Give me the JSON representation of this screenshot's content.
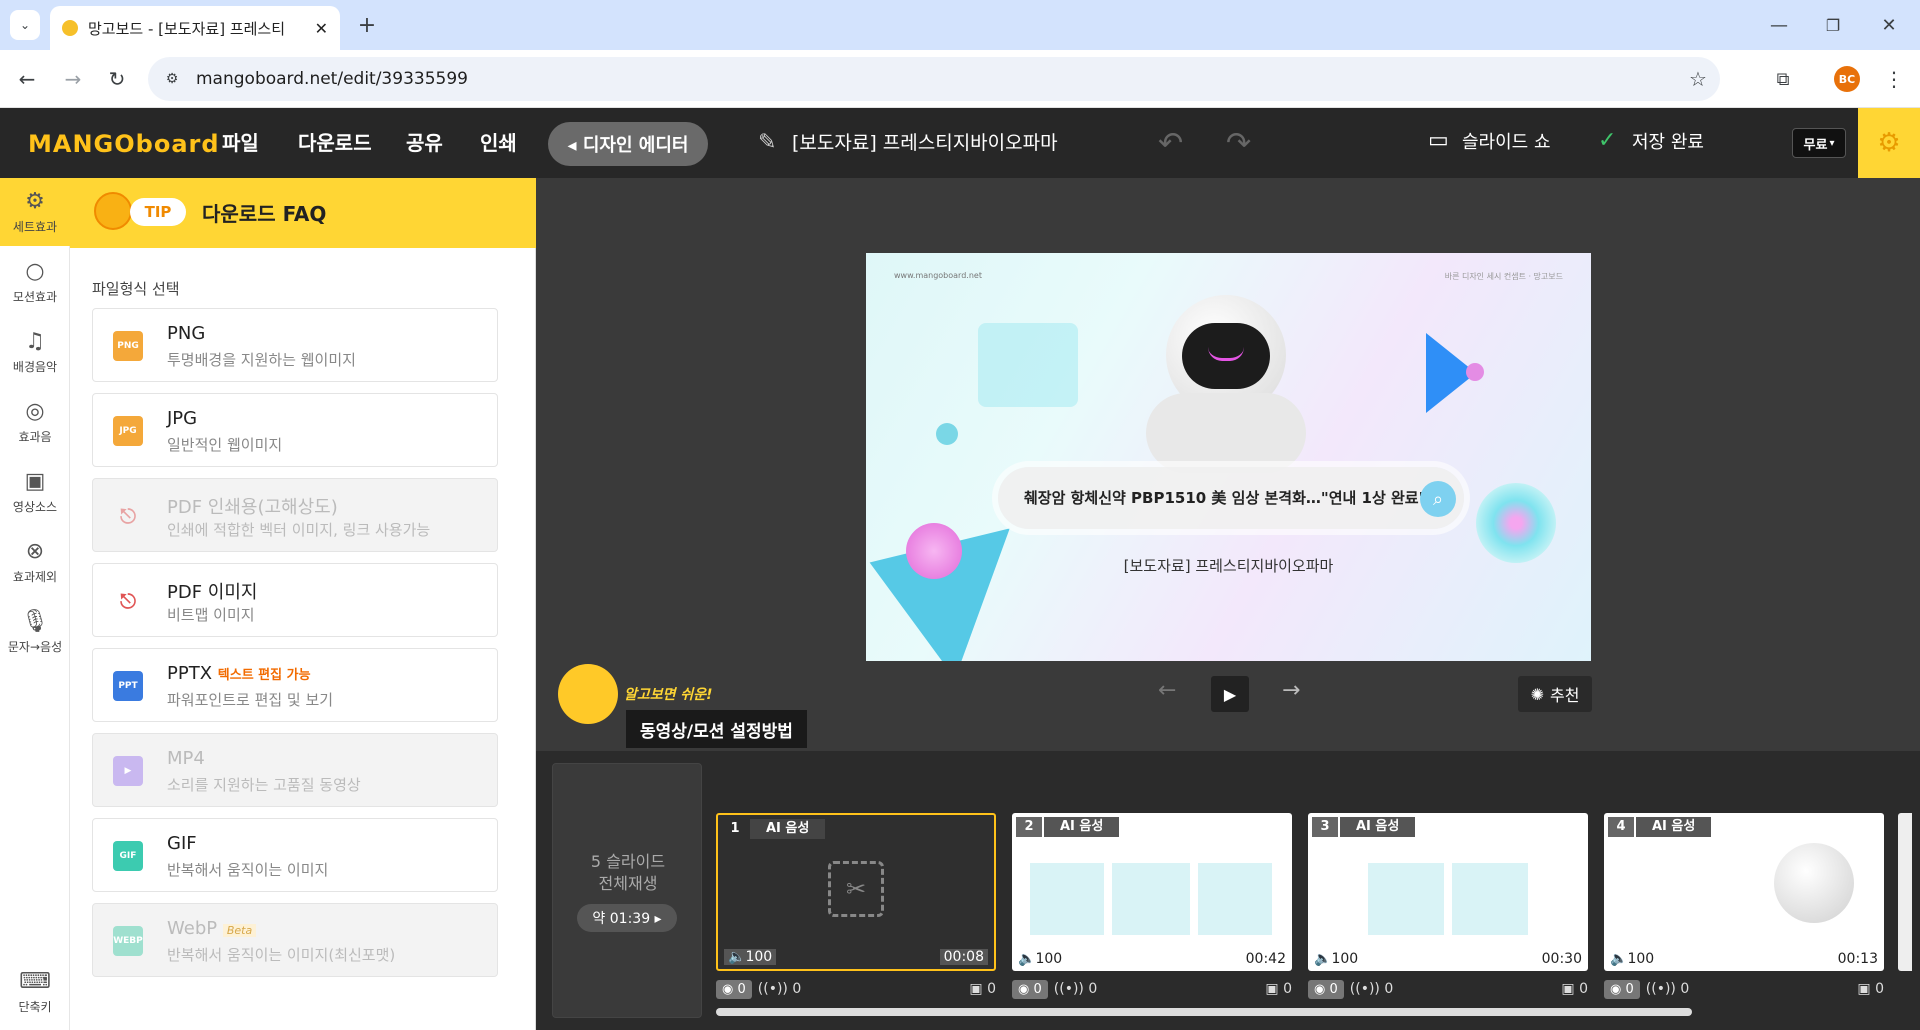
{
  "browser": {
    "tab_title": "망고보드 - [보도자료] 프레스티",
    "url": "mangoboard.net/edit/39335599",
    "profile": "BC"
  },
  "header": {
    "logo": "MANGOboard",
    "menu": [
      "파일",
      "다운로드",
      "공유",
      "인쇄"
    ],
    "design_editor": "◂ 디자인 에디터",
    "doc_title": "[보도자료] 프레스티지바이오파마",
    "slideshow": "슬라이드 쇼",
    "save_status": "저장 완료",
    "plan": "무료"
  },
  "tools": [
    {
      "label": "세트효과",
      "icon": "gear-icon"
    },
    {
      "label": "모션효과",
      "icon": "circle-icon"
    },
    {
      "label": "배경음악",
      "icon": "music-icon"
    },
    {
      "label": "효과음",
      "icon": "target-icon"
    },
    {
      "label": "영상소스",
      "icon": "film-icon"
    },
    {
      "label": "효과제외",
      "icon": "cancel-icon"
    },
    {
      "label": "문자→음성",
      "icon": "mic-icon"
    },
    {
      "label": "단축키",
      "icon": "keyboard-icon"
    }
  ],
  "panel": {
    "tip_badge": "TIP",
    "tip_title": "다운로드 FAQ",
    "section_label": "파일형식 선택",
    "formats": [
      {
        "name": "PNG",
        "desc": "투명배경을 지원하는 웹이미지",
        "color": "#f4a83a",
        "enabled": true,
        "tag": ""
      },
      {
        "name": "JPG",
        "desc": "일반적인 웹이미지",
        "color": "#f4a83a",
        "enabled": true,
        "tag": ""
      },
      {
        "name": "PDF 인쇄용(고해상도)",
        "desc": "인쇄에 적합한 벡터 이미지, 링크 사용가능",
        "color": "#e8a3a3",
        "enabled": false,
        "tag": ""
      },
      {
        "name": "PDF 이미지",
        "desc": "비트맵 이미지",
        "color": "#e05555",
        "enabled": true,
        "tag": ""
      },
      {
        "name": "PPTX",
        "desc": "파워포인트로 편집 및 보기",
        "color": "#3a7be0",
        "enabled": true,
        "tag": "텍스트 편집 가능"
      },
      {
        "name": "MP4",
        "desc": "소리를 지원하는 고품질 동영상",
        "color": "#c9b8f0",
        "enabled": false,
        "tag": ""
      },
      {
        "name": "GIF",
        "desc": "반복해서 움직이는 이미지",
        "color": "#3ccbb0",
        "enabled": true,
        "tag": ""
      },
      {
        "name": "WebP",
        "desc": "반복해서 움직이는 이미지(최신포맷)",
        "color": "#9fe0cf",
        "enabled": false,
        "tag": "Beta"
      }
    ]
  },
  "slide": {
    "site": "www.mangoboard.net",
    "top_right": "바른 디자인 세시 컨셉트 · 망고보드",
    "search_text": "췌장암 항체신약 PBP1510 美 임상 본격화…\"연내 1상 완료\"",
    "caption": "[보도자료] 프레스티지바이오파마"
  },
  "player": {
    "recommend": "추천"
  },
  "guide": {
    "small": "알고보면 쉬운!",
    "title": "동영상/모션 설정방법"
  },
  "timeline": {
    "play_all_line1": "5 슬라이드",
    "play_all_line2": "전체재생",
    "total_time": "약 01:39 ▸",
    "slides": [
      {
        "num": "1",
        "label": "AI 음성",
        "vol": "100",
        "dur": "00:08"
      },
      {
        "num": "2",
        "label": "AI 음성",
        "vol": "100",
        "dur": "00:42"
      },
      {
        "num": "3",
        "label": "AI 음성",
        "vol": "100",
        "dur": "00:30"
      },
      {
        "num": "4",
        "label": "AI 음성",
        "vol": "100",
        "dur": "00:13"
      }
    ],
    "counts": {
      "motion": "0",
      "sound": "0",
      "video": "0"
    }
  }
}
